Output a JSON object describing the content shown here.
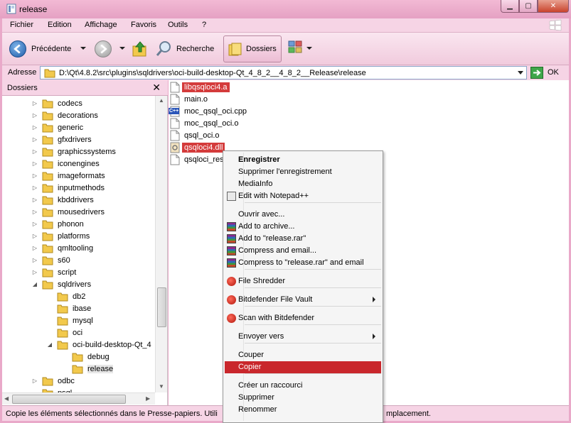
{
  "window": {
    "title": "release",
    "min_glyph": "▁",
    "max_glyph": "▢",
    "close_glyph": "✕"
  },
  "menu": [
    "Fichier",
    "Edition",
    "Affichage",
    "Favoris",
    "Outils",
    "?"
  ],
  "toolbar": {
    "back_label": "Précédente",
    "search_label": "Recherche",
    "folders_label": "Dossiers"
  },
  "address": {
    "label": "Adresse",
    "path": "D:\\Qt\\4.8.2\\src\\plugins\\sqldrivers\\oci-build-desktop-Qt_4_8_2__4_8_2__Release\\release",
    "ok_label": "OK"
  },
  "folders_pane": {
    "title": "Dossiers",
    "items": [
      {
        "label": "codecs",
        "expander": "▷"
      },
      {
        "label": "decorations",
        "expander": "▷"
      },
      {
        "label": "generic",
        "expander": "▷"
      },
      {
        "label": "gfxdrivers",
        "expander": "▷"
      },
      {
        "label": "graphicssystems",
        "expander": "▷"
      },
      {
        "label": "iconengines",
        "expander": "▷"
      },
      {
        "label": "imageformats",
        "expander": "▷"
      },
      {
        "label": "inputmethods",
        "expander": "▷"
      },
      {
        "label": "kbddrivers",
        "expander": "▷"
      },
      {
        "label": "mousedrivers",
        "expander": "▷"
      },
      {
        "label": "phonon",
        "expander": "▷"
      },
      {
        "label": "platforms",
        "expander": "▷"
      },
      {
        "label": "qmltooling",
        "expander": "▷"
      },
      {
        "label": "s60",
        "expander": "▷"
      },
      {
        "label": "script",
        "expander": "▷"
      },
      {
        "label": "sqldrivers",
        "expander": "◢"
      },
      {
        "label": "db2",
        "expander": ""
      },
      {
        "label": "ibase",
        "expander": ""
      },
      {
        "label": "mysql",
        "expander": ""
      },
      {
        "label": "oci",
        "expander": ""
      },
      {
        "label": "oci-build-desktop-Qt_4",
        "expander": "◢"
      },
      {
        "label": "debug",
        "expander": ""
      },
      {
        "label": "release",
        "expander": ""
      },
      {
        "label": "odbc",
        "expander": "▷"
      },
      {
        "label": "psql",
        "expander": ""
      }
    ]
  },
  "files": [
    {
      "name": "libqsqloci4.a",
      "icon": "file-a-icon"
    },
    {
      "name": "main.o",
      "icon": "file-icon"
    },
    {
      "name": "moc_qsql_oci.cpp",
      "icon": "cpp-file-icon"
    },
    {
      "name": "moc_qsql_oci.o",
      "icon": "file-icon"
    },
    {
      "name": "qsql_oci.o",
      "icon": "file-icon"
    },
    {
      "name": "qsqloci4.dll",
      "icon": "dll-file-icon"
    },
    {
      "name": "qsqloci_res",
      "icon": "file-icon"
    }
  ],
  "cpp_badge": "C++",
  "context_menu": {
    "items": [
      {
        "label": "Enregistrer"
      },
      {
        "label": "Supprimer l'enregistrement"
      },
      {
        "label": "MediaInfo"
      },
      {
        "label": "Edit with Notepad++"
      },
      {
        "label": "Ouvrir avec..."
      },
      {
        "label": "Add to archive..."
      },
      {
        "label": "Add to \"release.rar\""
      },
      {
        "label": "Compress and email..."
      },
      {
        "label": "Compress to \"release.rar\" and email"
      },
      {
        "label": "File Shredder"
      },
      {
        "label": "Bitdefender File Vault"
      },
      {
        "label": "Scan with Bitdefender"
      },
      {
        "label": "Envoyer vers"
      },
      {
        "label": "Couper"
      },
      {
        "label": "Copier"
      },
      {
        "label": "Créer un raccourci"
      },
      {
        "label": "Supprimer"
      },
      {
        "label": "Renommer"
      }
    ]
  },
  "status": {
    "text": "Copie les éléments sélectionnés dans le Presse-papiers. Utili",
    "tail": "mplacement."
  },
  "colors": {
    "chrome_pink": "#f6d4e5",
    "highlight_red": "#c9272c",
    "file_highlight": "#d43b3b"
  }
}
